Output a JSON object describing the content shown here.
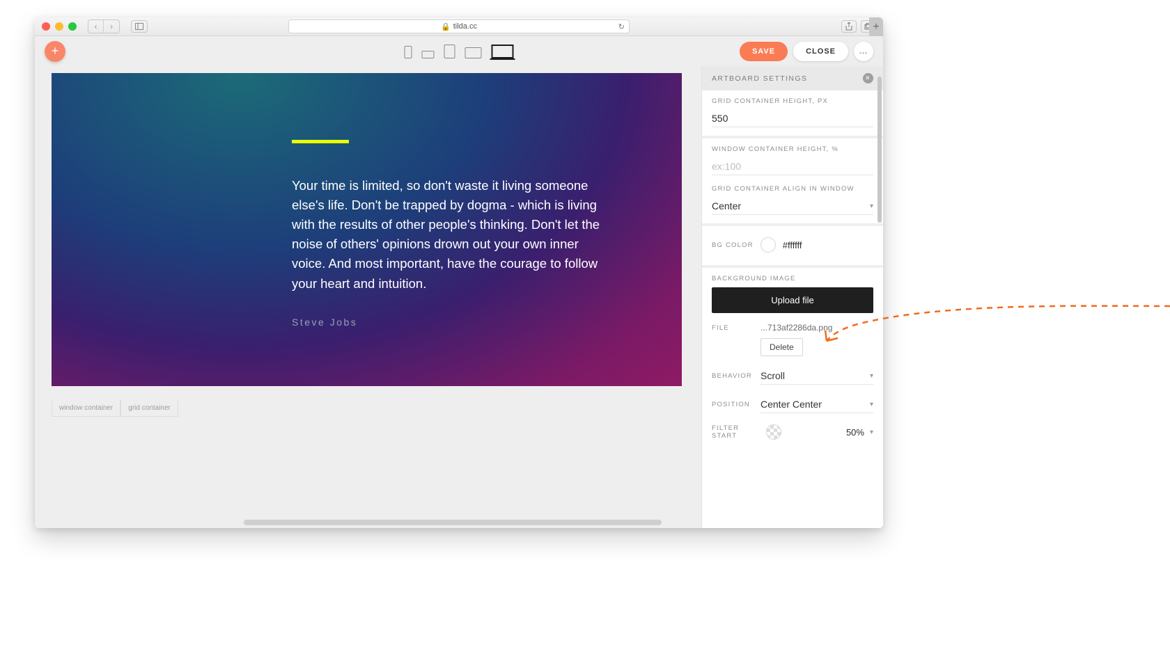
{
  "browser": {
    "url": "tilda.cc",
    "lock_icon": "🔒"
  },
  "topbar": {
    "save": "SAVE",
    "close": "CLOSE",
    "more": "..."
  },
  "canvas": {
    "quote": "Your time is limited, so don't waste it living someone else's life. Don't be trapped by dogma - which is living with the results of other people's thinking. Don't let the noise of others' opinions drown out your own inner voice. And most important, have the courage to follow your heart and intuition.",
    "author": "Steve Jobs",
    "tab_window": "window container",
    "tab_grid": "grid container"
  },
  "sidebar": {
    "title": "ARTBOARD SETTINGS",
    "grid_height_label": "GRID CONTAINER HEIGHT, PX",
    "grid_height_value": "550",
    "window_height_label": "WINDOW CONTAINER HEIGHT, %",
    "window_height_placeholder": "ex:100",
    "grid_align_label": "GRID CONTAINER ALIGN IN WINDOW",
    "grid_align_value": "Center",
    "bg_color_label": "BG COLOR",
    "bg_color_value": "#ffffff",
    "bg_image_label": "BACKGROUND IMAGE",
    "upload_label": "Upload file",
    "file_label": "FILE",
    "file_name": "...713af2286da.png",
    "delete_label": "Delete",
    "behavior_label": "BEHAVIOR",
    "behavior_value": "Scroll",
    "position_label": "POSITION",
    "position_value": "Center Center",
    "filter_label": "FILTER START",
    "filter_value": "50%"
  }
}
